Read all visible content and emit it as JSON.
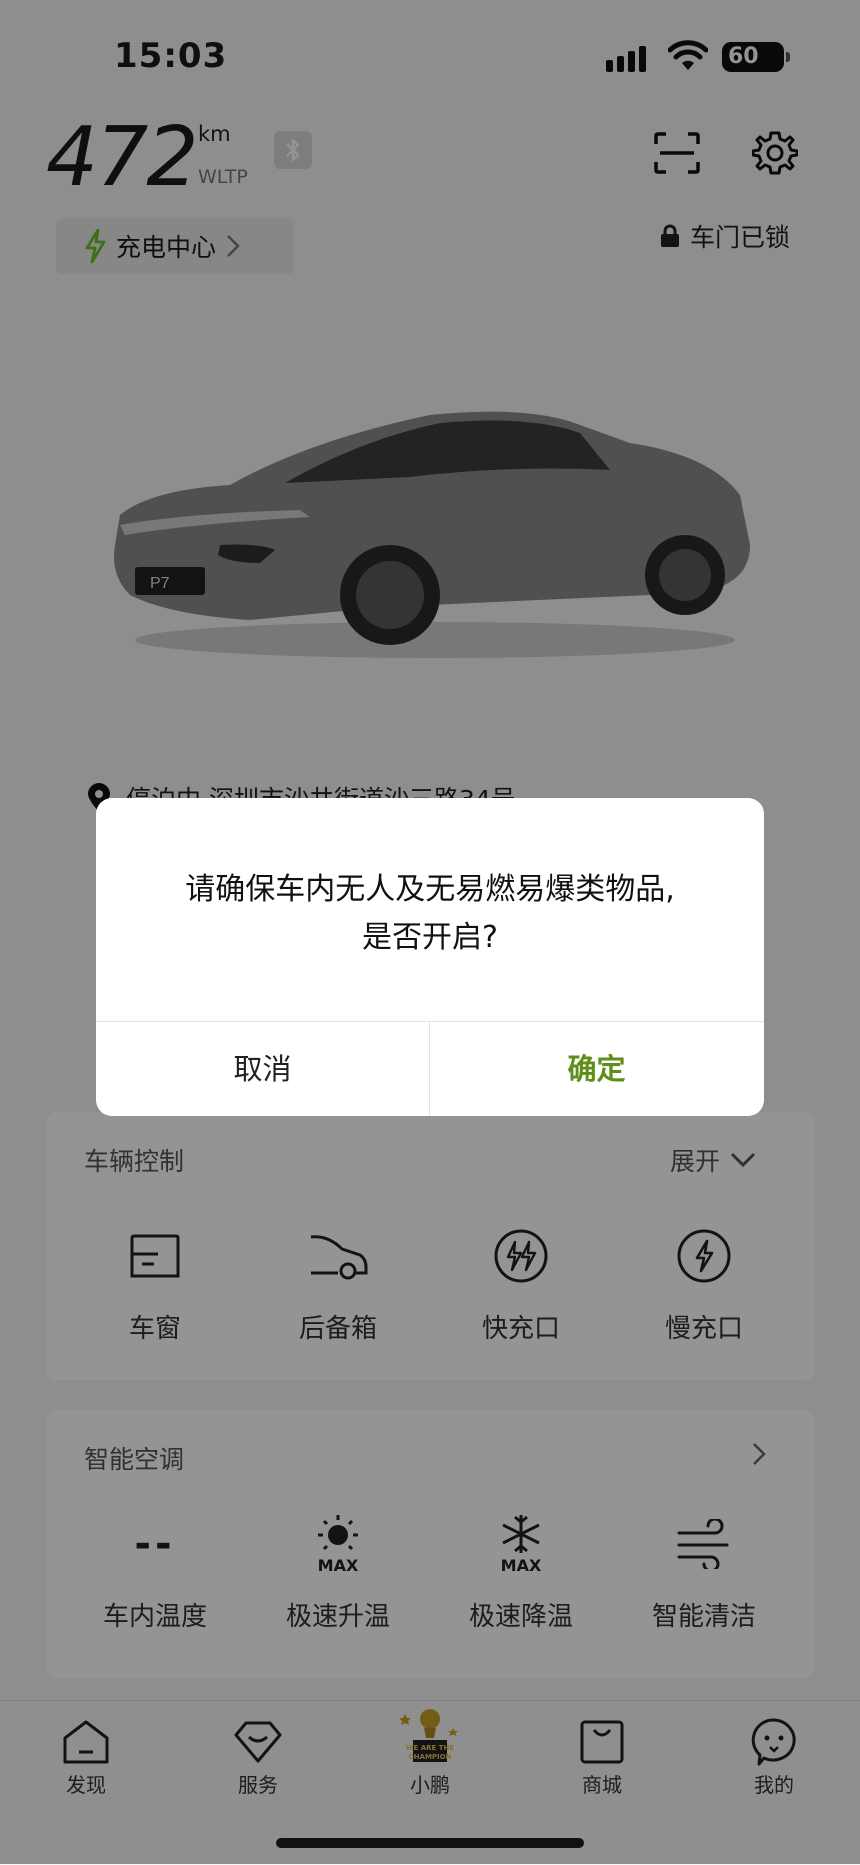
{
  "status_bar": {
    "time": "15:03",
    "battery": "60"
  },
  "vehicle": {
    "range": "472",
    "range_unit": "km",
    "range_cycle": "WLTP",
    "charge_center_label": "充电中心",
    "door_status": "车门已锁",
    "location_text": "停泊中 深圳市沙井街道沙三路34号",
    "plate_text": "P7"
  },
  "vehicle_control": {
    "title": "车辆控制",
    "expand_label": "展开",
    "items": [
      {
        "label": "车窗",
        "icon": "window-icon"
      },
      {
        "label": "后备箱",
        "icon": "trunk-icon"
      },
      {
        "label": "快充口",
        "icon": "fast-charge-port-icon"
      },
      {
        "label": "慢充口",
        "icon": "slow-charge-port-icon"
      }
    ]
  },
  "smart_ac": {
    "title": "智能空调",
    "items": [
      {
        "label": "车内温度",
        "value": "--",
        "icon": "temperature-icon"
      },
      {
        "label": "极速升温",
        "icon": "max-heat-icon"
      },
      {
        "label": "极速降温",
        "icon": "max-cool-icon"
      },
      {
        "label": "智能清洁",
        "icon": "smart-clean-icon"
      }
    ]
  },
  "bottom_nav": [
    {
      "label": "发现",
      "icon": "home-icon"
    },
    {
      "label": "服务",
      "icon": "service-icon"
    },
    {
      "label": "小鹏",
      "icon": "champion-badge-icon",
      "badge_text": "WE ARE THE CHAMPION"
    },
    {
      "label": "商城",
      "icon": "shop-icon"
    },
    {
      "label": "我的",
      "icon": "profile-icon"
    }
  ],
  "dialog": {
    "message_line1": "请确保车内无人及无易燃易爆类物品,",
    "message_line2": "是否开启?",
    "cancel_label": "取消",
    "confirm_label": "确定"
  },
  "colors": {
    "accent_green": "#5f8f1a",
    "charge_icon_green": "#6bbf2a"
  }
}
